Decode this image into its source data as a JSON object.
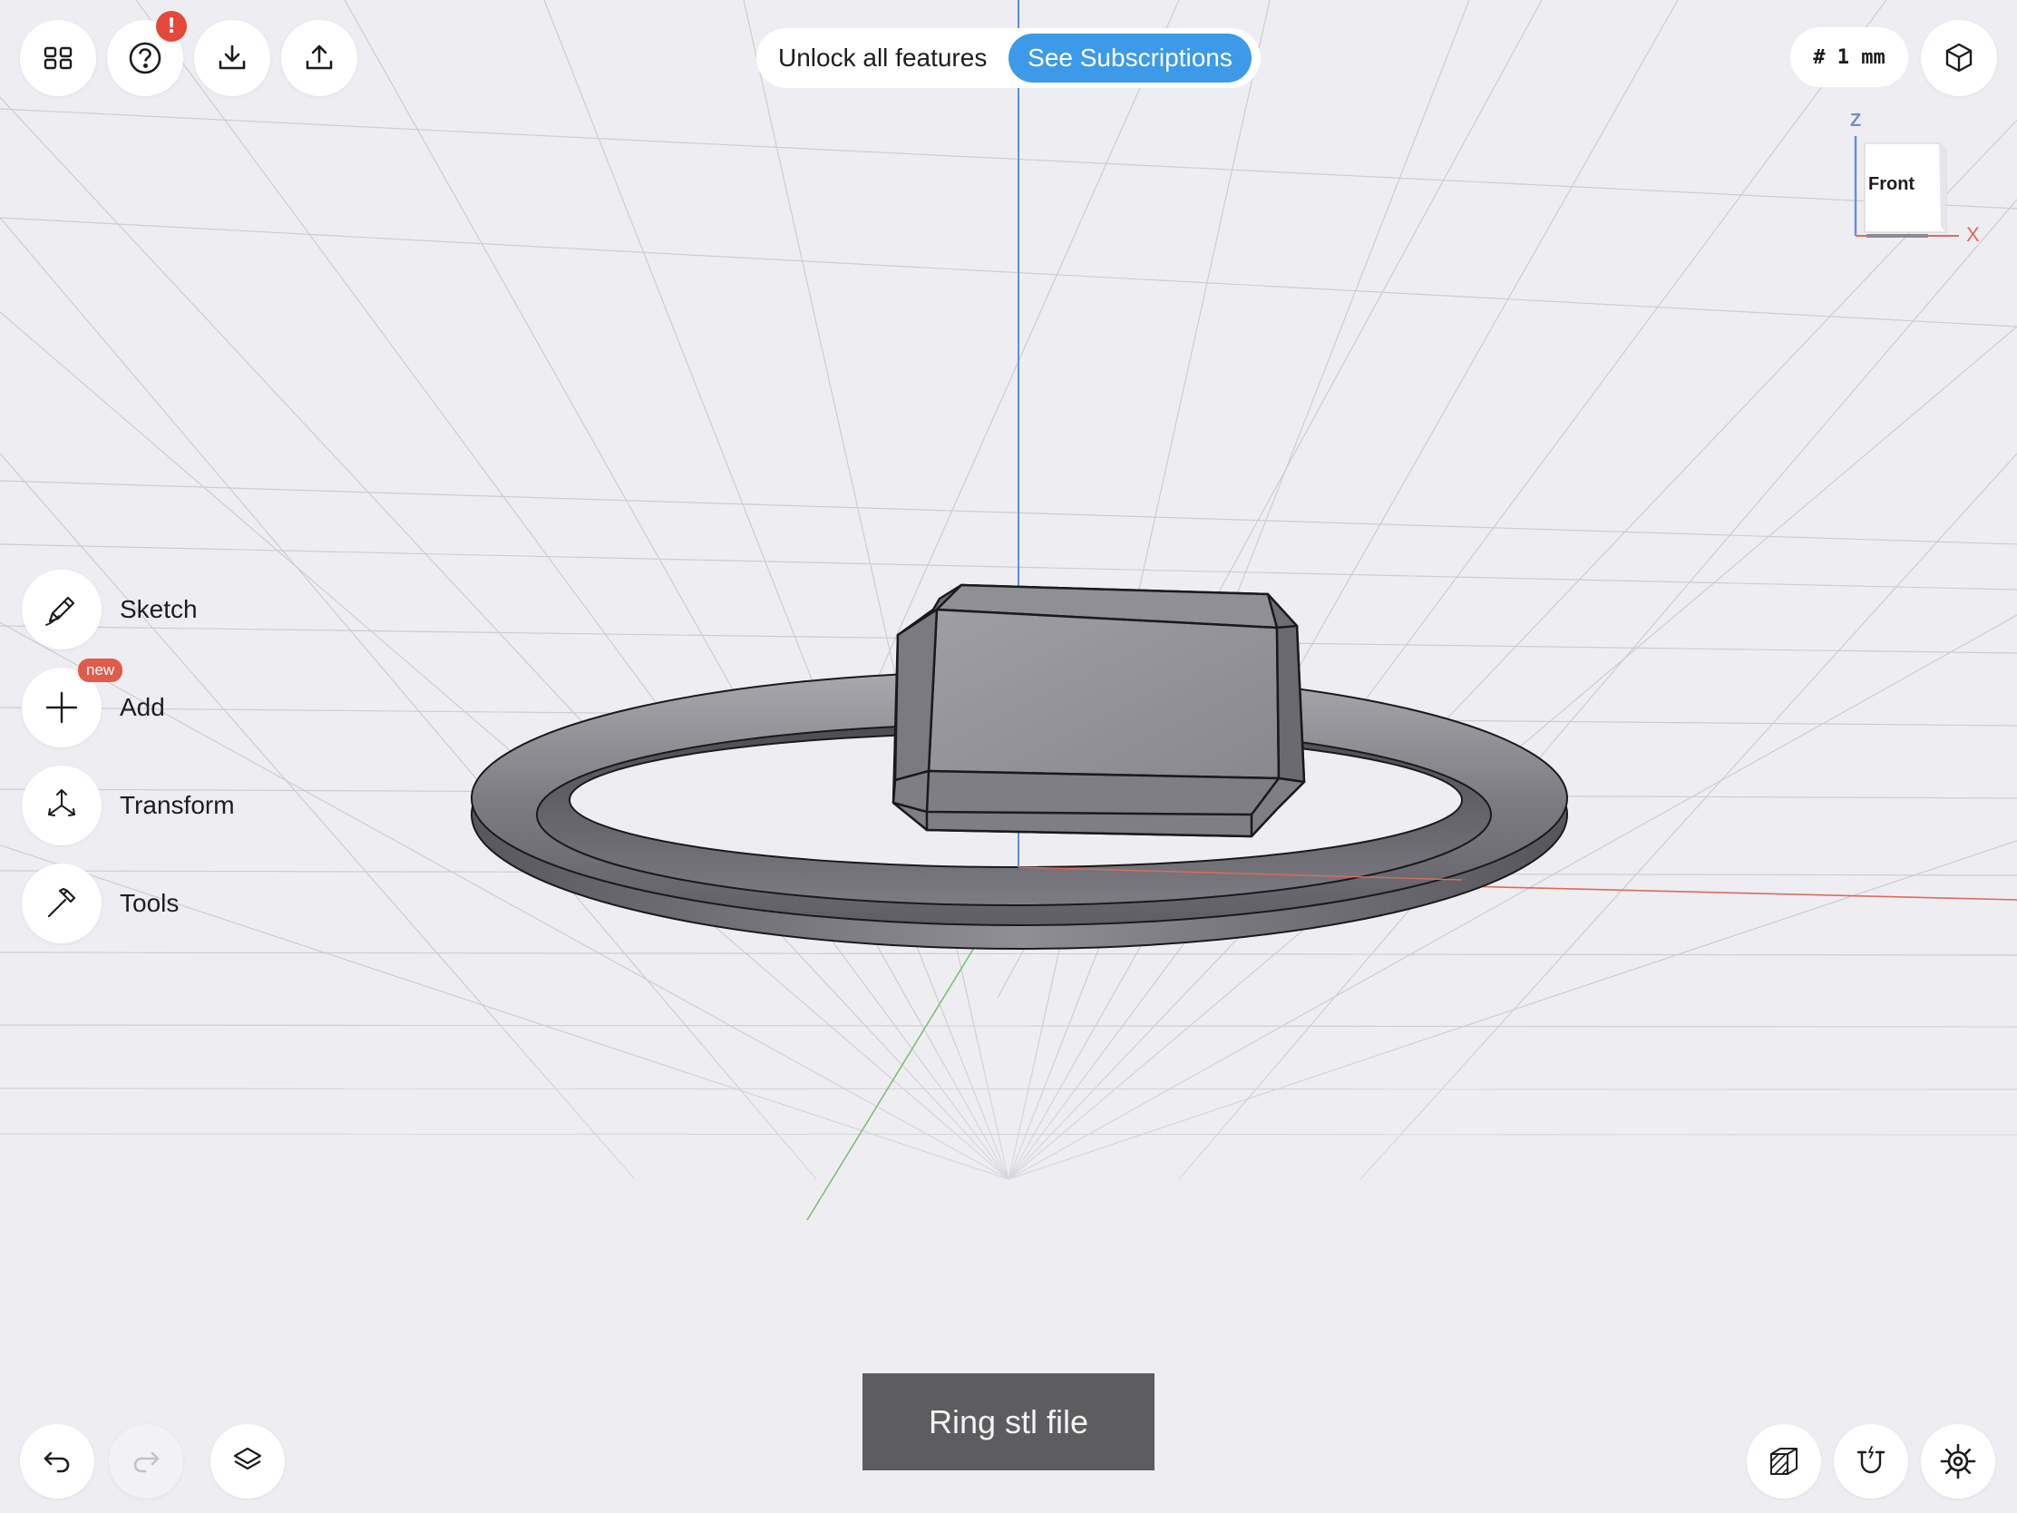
{
  "app": {
    "toolbar_top_left": [
      {
        "name": "menu-grid",
        "icon": "grid-icon"
      },
      {
        "name": "help",
        "icon": "question-icon",
        "alert": "!"
      },
      {
        "name": "import",
        "icon": "download-icon"
      },
      {
        "name": "export",
        "icon": "share-icon"
      }
    ],
    "promo": {
      "text": "Unlock all features",
      "button_label": "See Subscriptions",
      "button_color": "#3d9ae8"
    },
    "grid_size": "# 1 mm",
    "view_cube": {
      "face": "Front",
      "axis_z": "Z",
      "axis_x": "X"
    },
    "sidebar": [
      {
        "label": "Sketch",
        "icon": "pencil-icon"
      },
      {
        "label": "Add",
        "icon": "plus-icon",
        "badge": "new"
      },
      {
        "label": "Transform",
        "icon": "transform-icon"
      },
      {
        "label": "Tools",
        "icon": "hammer-icon"
      }
    ],
    "toast": "Ring stl file",
    "bottom_left": [
      {
        "name": "undo",
        "icon": "undo-icon",
        "enabled": true
      },
      {
        "name": "redo",
        "icon": "redo-icon",
        "enabled": false
      },
      {
        "name": "layers",
        "icon": "layers-icon"
      }
    ],
    "bottom_right": [
      {
        "name": "material",
        "icon": "hatched-cube-icon"
      },
      {
        "name": "snap",
        "icon": "magnet-icon"
      },
      {
        "name": "settings",
        "icon": "gear-icon"
      }
    ],
    "colors": {
      "background": "#eeeef2",
      "axis_z": "#5b8fe0",
      "axis_x": "#e06a5c",
      "axis_y": "#7dbf78",
      "alert": "#e5483b",
      "badge_new": "#df5b4c"
    }
  }
}
